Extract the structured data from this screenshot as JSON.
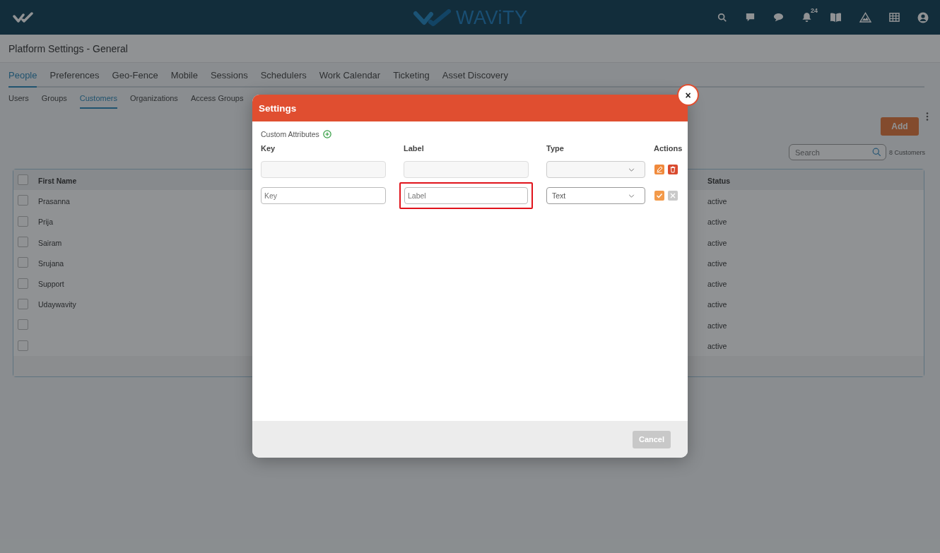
{
  "header": {
    "logo_text": "WAViTY",
    "notification_count": "24"
  },
  "page_title": "Platform Settings - General",
  "tabs": [
    {
      "label": "People",
      "selected": true
    },
    {
      "label": "Preferences",
      "selected": false
    },
    {
      "label": "Geo-Fence",
      "selected": false
    },
    {
      "label": "Mobile",
      "selected": false
    },
    {
      "label": "Sessions",
      "selected": false
    },
    {
      "label": "Schedulers",
      "selected": false
    },
    {
      "label": "Work Calendar",
      "selected": false
    },
    {
      "label": "Ticketing",
      "selected": false
    },
    {
      "label": "Asset Discovery",
      "selected": false
    }
  ],
  "subtabs": [
    {
      "label": "Users",
      "selected": false
    },
    {
      "label": "Groups",
      "selected": false
    },
    {
      "label": "Customers",
      "selected": true
    },
    {
      "label": "Organizations",
      "selected": false
    },
    {
      "label": "Access Groups",
      "selected": false
    }
  ],
  "add_button": "Add",
  "search": {
    "placeholder": "Search"
  },
  "count": "8 Customers",
  "table": {
    "header_checked": false,
    "columns": [
      "First Name",
      "Status"
    ],
    "rows": [
      {
        "checked": false,
        "first_name": "Prasanna",
        "status": "active"
      },
      {
        "checked": false,
        "first_name": "Prija",
        "status": "active"
      },
      {
        "checked": false,
        "first_name": "Sairam",
        "status": "active"
      },
      {
        "checked": false,
        "first_name": "Srujana",
        "status": "active"
      },
      {
        "checked": false,
        "first_name": "Support",
        "status": "active"
      },
      {
        "checked": false,
        "first_name": "Udaywavity",
        "status": "active"
      },
      {
        "checked": false,
        "status": "active"
      },
      {
        "checked": false,
        "status": "active"
      }
    ]
  },
  "dialog": {
    "title": "Settings",
    "close": "×",
    "section": "Custom Attributes",
    "columns": [
      "Key",
      "Label",
      "Type",
      "Actions"
    ],
    "rows": [
      {
        "kind": "saved"
      },
      {
        "kind": "new",
        "key_placeholder": "Key",
        "label_placeholder": "Label",
        "label_highlighted": true,
        "type": "Text"
      }
    ],
    "cancel": {
      "label": "Cancel",
      "disabled": true
    }
  }
}
